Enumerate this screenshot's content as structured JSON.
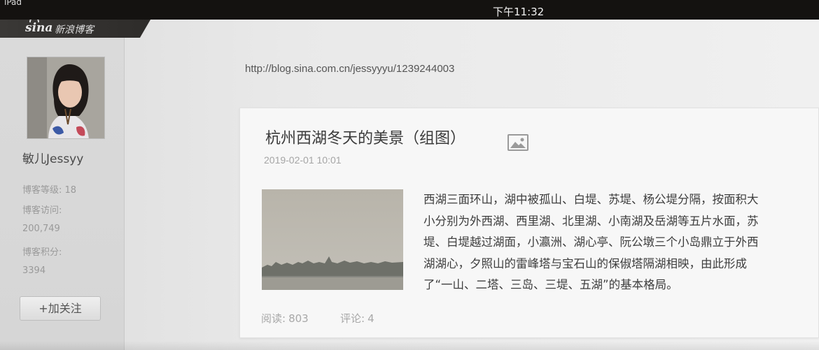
{
  "status_bar": {
    "device": "iPad",
    "time": "下午11:32"
  },
  "sidebar": {
    "logo_sina": "sina",
    "logo_text": "新浪博客",
    "username": "敏儿Jessyy",
    "stats": {
      "level_label": "博客等级:",
      "level_value": "18",
      "visits_label": "博客访问:",
      "visits_value": "200,749",
      "points_label": "博客积分:",
      "points_value": "3394"
    },
    "follow_button": "+加关注"
  },
  "main": {
    "url": "http://blog.sina.com.cn/jessyyyu/1239244003",
    "post": {
      "title": "杭州西湖冬天的美景（组图）",
      "date": "2019-02-01 10:01",
      "icon": "image-icon",
      "excerpt_lines": [
        "西湖三面环山，湖中被孤山、白堤、苏堤、杨公堤分隔，按面积大",
        "小分别为外西湖、西里湖、北里湖、小南湖及岳湖等五片水面，苏",
        "堤、白堤越过湖面，小瀛洲、湖心亭、阮公墩三个小岛鼎立于外西",
        "湖湖心，夕照山的雷峰塔与宝石山的保俶塔隔湖相映，由此形成",
        "了“一山、二塔、三岛、三堤、五湖”的基本格局。"
      ],
      "reads_label": "阅读:",
      "reads_value": "803",
      "comments_label": "评论:",
      "comments_value": "4"
    }
  },
  "colors": {
    "status_bar": "#141210",
    "logo_bar": "#33312f",
    "sidebar": "#d8d8d8",
    "card": "#f7f7f7",
    "text": "#3d3d3d",
    "muted": "#a5a5a5"
  }
}
